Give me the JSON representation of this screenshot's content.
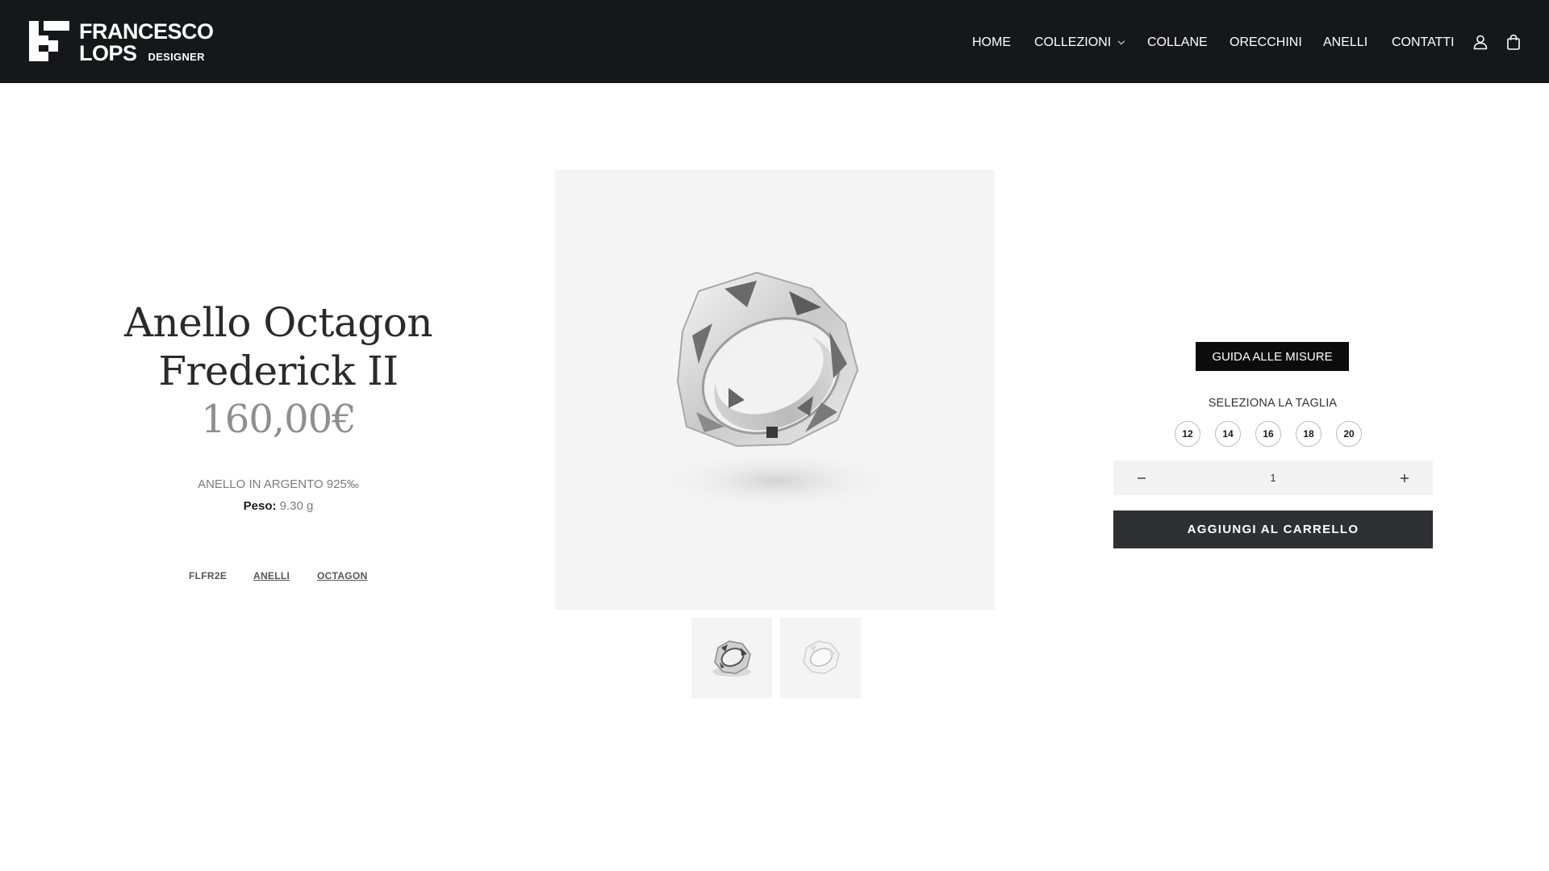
{
  "header": {
    "logo": {
      "line1": "FRANCESCO",
      "line2": "LOPS",
      "sub": "DESIGNER"
    },
    "nav": [
      {
        "label": "HOME"
      },
      {
        "label": "COLLEZIONI"
      },
      {
        "label": "COLLANE"
      },
      {
        "label": "ORECCHINI"
      },
      {
        "label": "ANELLI"
      },
      {
        "label": "CONTATTI"
      }
    ],
    "icons": [
      "user-icon",
      "shopping-bag-icon"
    ]
  },
  "product": {
    "title_line1": "Anello Octagon",
    "title_line2": "Frederick II",
    "price": "160,00€",
    "description": "ANELLO IN ARGENTO 925‰",
    "weight_label": "Peso:",
    "weight_value": "9.30 g",
    "sku": "FLFR2E",
    "categories": [
      "ANELLI",
      "OCTAGON"
    ]
  },
  "gallery": {
    "thumbnails": [
      "ring-photo-silver",
      "ring-photo-white"
    ]
  },
  "purchase": {
    "size_guide_label": "GUIDA ALLE MISURE",
    "select_size_label": "SELEZIONA LA TAGLIA",
    "sizes": [
      "12",
      "14",
      "16",
      "18",
      "20"
    ],
    "quantity": "1",
    "add_to_cart_label": "AGGIUNGI AL CARRELLO"
  },
  "colors": {
    "header_bg": "#15171b",
    "button_dark": "#2f3034",
    "size_guide_bg": "#0c0c0c",
    "price": "#8e8e8e"
  }
}
